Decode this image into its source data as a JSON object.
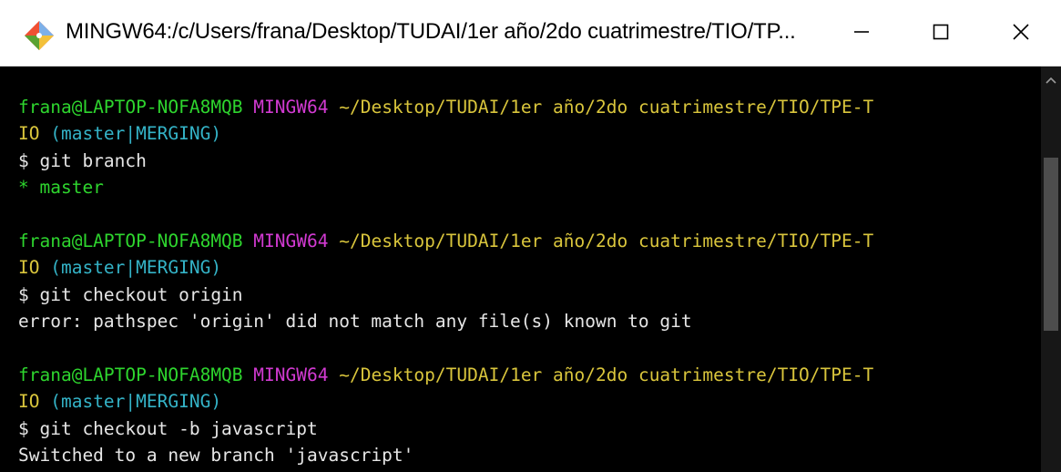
{
  "window": {
    "title": "MINGW64:/c/Users/frana/Desktop/TUDAI/1er año/2do cuatrimestre/TIO/TP...",
    "app_icon": "git-diamond-icon",
    "controls": [
      "minimize-icon",
      "maximize-icon",
      "close-icon"
    ]
  },
  "terminal": {
    "blocks": [
      {
        "user": "frana@LAPTOP-NOFA8MQB",
        "env": "MINGW64",
        "path": "~/Desktop/TUDAI/1er año/2do cuatrimestre/TIO/TPE-T",
        "path_wrap": "IO",
        "branch": "(master|MERGING)",
        "command": "$ git branch",
        "output": "* master"
      },
      {
        "user": "frana@LAPTOP-NOFA8MQB",
        "env": "MINGW64",
        "path": "~/Desktop/TUDAI/1er año/2do cuatrimestre/TIO/TPE-T",
        "path_wrap": "IO",
        "branch": "(master|MERGING)",
        "command": "$ git checkout origin",
        "output": "error: pathspec 'origin' did not match any file(s) known to git"
      },
      {
        "user": "frana@LAPTOP-NOFA8MQB",
        "env": "MINGW64",
        "path": "~/Desktop/TUDAI/1er año/2do cuatrimestre/TIO/TPE-T",
        "path_wrap": "IO",
        "branch": "(master|MERGING)",
        "command": "$ git checkout -b javascript",
        "output": "Switched to a new branch 'javascript'"
      }
    ]
  },
  "colors": {
    "user": "#2ed52e",
    "env": "#d23ad2",
    "path": "#d9c53c",
    "branch": "#34b3c7",
    "text": "#e6e6e6",
    "background": "#000000"
  }
}
